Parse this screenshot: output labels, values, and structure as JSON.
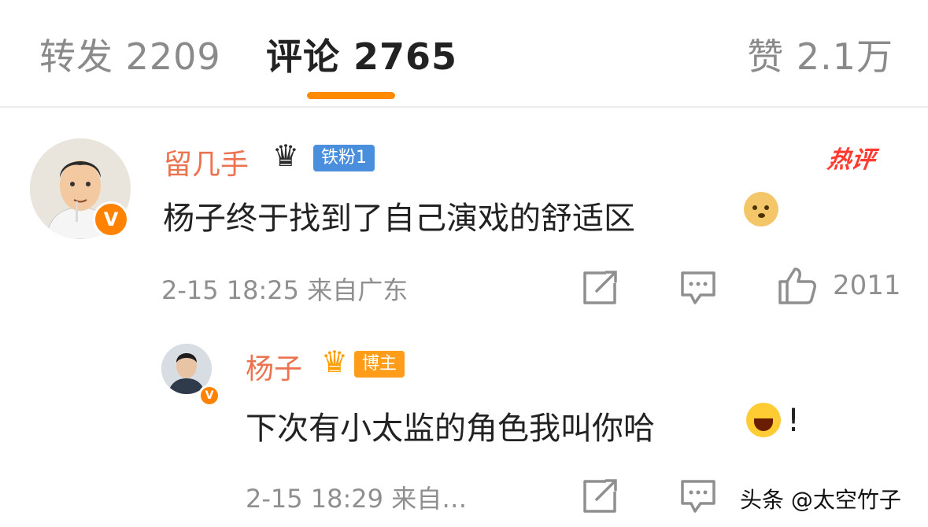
{
  "tabs": {
    "repost": "转发 2209",
    "comments": "评论 2765",
    "likes": "赞 2.1万"
  },
  "colors": {
    "accent": "#ff8a00",
    "username": "#eb7350",
    "hot": "#ff3b30",
    "fan_badge": "#4a8fdd",
    "blogger_badge": "#ff9c1a"
  },
  "comment": {
    "username": "留几手",
    "fan_badge": "铁粉1",
    "hot_tag": "热评",
    "text": "杨子终于找到了自己演戏的舒适区",
    "emoji": "doge-icon",
    "time": "2-15 18:25",
    "location": "来自广东",
    "like_count": "2011",
    "verified_mark": "V"
  },
  "reply": {
    "username": "杨子",
    "blogger_badge": "博主",
    "text": "下次有小太监的角色我叫你哈",
    "emoji": "laugh-icon",
    "exclaim": "!",
    "time": "2-15 18:29",
    "location": "来自…",
    "verified_mark": "V"
  },
  "watermark": "头条 @太空竹子"
}
